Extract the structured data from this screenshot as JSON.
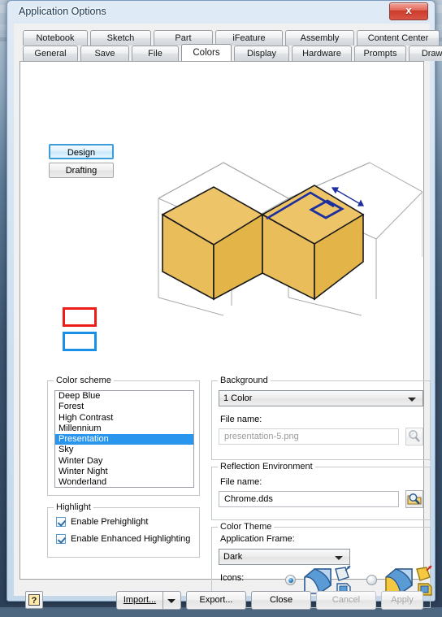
{
  "window": {
    "title": "Application Options",
    "close_label": "x"
  },
  "tabs": {
    "row1": [
      {
        "label": "Notebook",
        "selected": false
      },
      {
        "label": "Sketch",
        "selected": false
      },
      {
        "label": "Part",
        "selected": false
      },
      {
        "label": "iFeature",
        "selected": false
      },
      {
        "label": "Assembly",
        "selected": false
      },
      {
        "label": "Content Center",
        "selected": false
      }
    ],
    "row2": [
      {
        "label": "General",
        "selected": false
      },
      {
        "label": "Save",
        "selected": false
      },
      {
        "label": "File",
        "selected": false
      },
      {
        "label": "Colors",
        "selected": true
      },
      {
        "label": "Display",
        "selected": false
      },
      {
        "label": "Hardware",
        "selected": false
      },
      {
        "label": "Prompts",
        "selected": false
      },
      {
        "label": "Drawing",
        "selected": false
      }
    ]
  },
  "mode": {
    "design_label": "Design",
    "drafting_label": "Drafting",
    "selected": "Design"
  },
  "swatches": {
    "red_color": "#ee1c19",
    "blue_color": "#1a8fe8"
  },
  "preview": {
    "model_fill": "#e9be5c",
    "model_fill_light": "#efca72",
    "model_edge": "#000000",
    "grid_color": "#9a9a9a",
    "annotation_color": "#1c2f9c"
  },
  "color_scheme": {
    "group_label": "Color scheme",
    "items": [
      "Deep Blue",
      "Forest",
      "High Contrast",
      "Millennium",
      "Presentation",
      "Sky",
      "Winter Day",
      "Winter Night",
      "Wonderland"
    ],
    "selected": "Presentation",
    "selected_bg": "#2a95ec"
  },
  "highlight": {
    "group_label": "Highlight",
    "checkboxes": [
      {
        "label": "Enable Prehighlight",
        "checked": true
      },
      {
        "label": "Enable Enhanced Highlighting",
        "checked": true
      }
    ]
  },
  "background": {
    "group_label": "Background",
    "combo_value": "1 Color",
    "file_name_label": "File name:",
    "file_name_value": "presentation-5.png",
    "file_name_disabled": true,
    "browse_icon": "browse-magnifier-icon",
    "browse_disabled": true
  },
  "reflection": {
    "group_label": "Reflection Environment",
    "file_name_label": "File name:",
    "file_name_value": "Chrome.dds",
    "browse_icon": "browse-magnifier-icon",
    "browse_disabled": false
  },
  "color_theme": {
    "group_label": "Color Theme",
    "app_frame_label": "Application Frame:",
    "app_frame_value": "Dark",
    "icons_label": "Icons:",
    "options": [
      {
        "name": "icon-theme-blue-grey",
        "selected": true
      },
      {
        "name": "icon-theme-amber",
        "selected": false
      }
    ]
  },
  "buttons": {
    "help": "?",
    "import": "Import...",
    "import_dropdown": "import-dropdown-arrow",
    "export": "Export...",
    "close": "Close",
    "cancel": "Cancel",
    "apply": "Apply",
    "cancel_disabled": true,
    "apply_disabled": true
  }
}
